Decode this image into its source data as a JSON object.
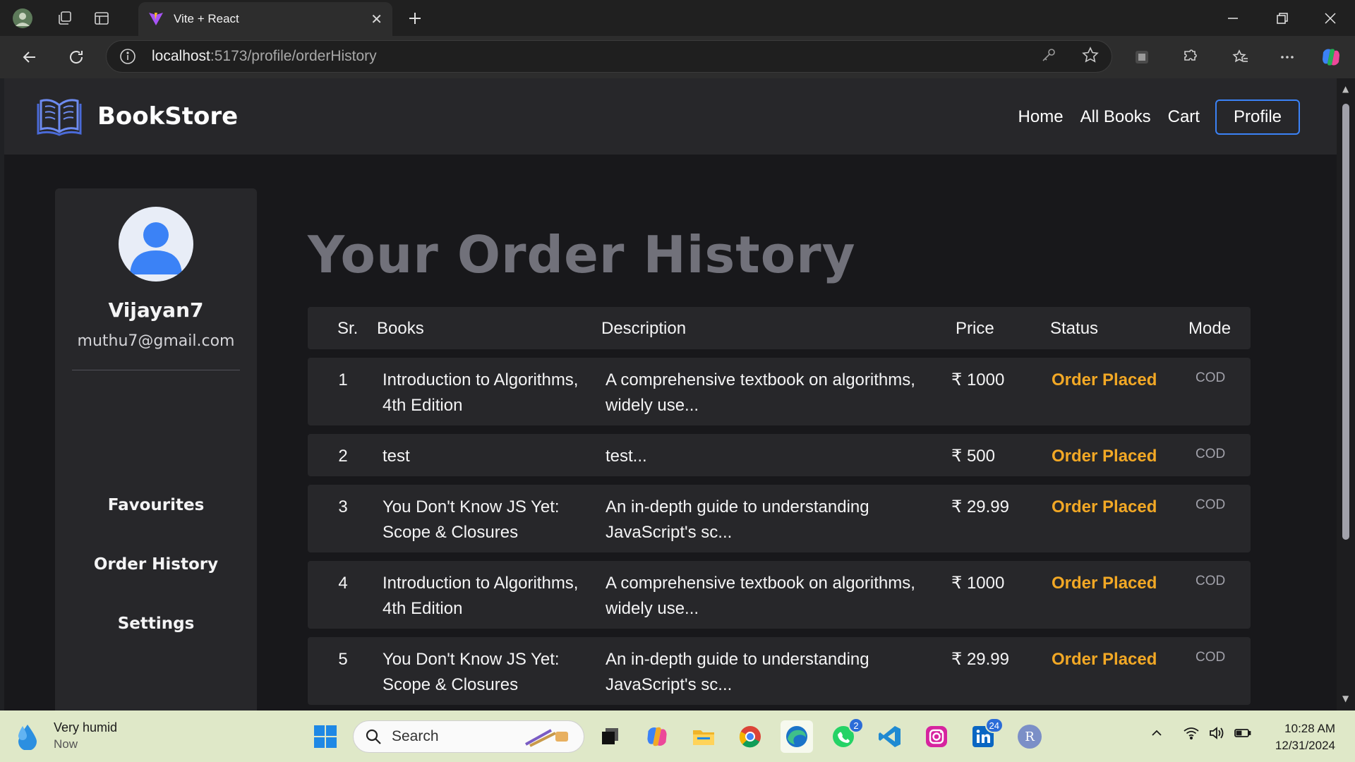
{
  "browser": {
    "tab_title": "Vite + React",
    "url_host": "localhost",
    "url_path": ":5173/profile/orderHistory"
  },
  "navbar": {
    "brand": "BookStore",
    "links": [
      "Home",
      "All Books",
      "Cart"
    ],
    "profile_label": "Profile"
  },
  "sidebar": {
    "username": "Vijayan7",
    "email": "muthu7@gmail.com",
    "items": [
      "Favourites",
      "Order History",
      "Settings"
    ]
  },
  "main": {
    "heading": "Your Order History",
    "columns": [
      "Sr.",
      "Books",
      "Description",
      "Price",
      "Status",
      "Mode"
    ],
    "orders": [
      {
        "sr": "1",
        "book": "Introduction to Algorithms, 4th Edition",
        "description": "A comprehensive textbook on algorithms, widely use...",
        "price": "₹ 1000",
        "status": "Order Placed",
        "mode": "COD"
      },
      {
        "sr": "2",
        "book": "test",
        "description": "test...",
        "price": "₹ 500",
        "status": "Order Placed",
        "mode": "COD"
      },
      {
        "sr": "3",
        "book": "You Don't Know JS Yet: Scope & Closures",
        "description": "An in-depth guide to understanding JavaScript's sc...",
        "price": "₹ 29.99",
        "status": "Order Placed",
        "mode": "COD"
      },
      {
        "sr": "4",
        "book": "Introduction to Algorithms, 4th Edition",
        "description": "A comprehensive textbook on algorithms, widely use...",
        "price": "₹ 1000",
        "status": "Order Placed",
        "mode": "COD"
      },
      {
        "sr": "5",
        "book": "You Don't Know JS Yet: Scope & Closures",
        "description": "An in-depth guide to understanding JavaScript's sc...",
        "price": "₹ 29.99",
        "status": "Order Placed",
        "mode": "COD"
      }
    ]
  },
  "taskbar": {
    "weather_title": "Very humid",
    "weather_sub": "Now",
    "search_placeholder": "Search",
    "whatsapp_badge": "2",
    "linkedin_badge": "24",
    "profile_initial": "R",
    "time": "10:28 AM",
    "date": "12/31/2024"
  },
  "colors": {
    "accent": "#3b82f6",
    "status": "#f2a825",
    "page_bg": "#18181b",
    "panel_bg": "#27272a"
  }
}
